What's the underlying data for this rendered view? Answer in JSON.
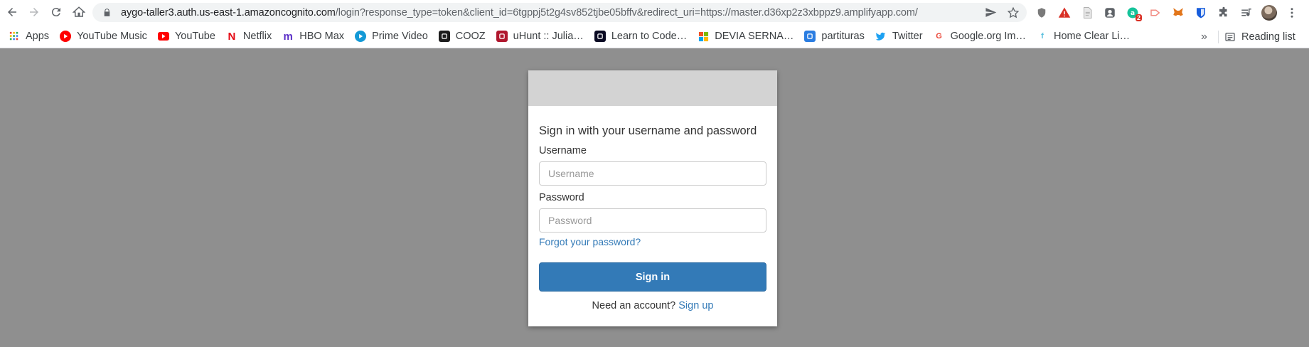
{
  "browser": {
    "url_host": "aygo-taller3.auth.us-east-1.amazoncognito.com",
    "url_path": "/login?response_type=token&client_id=6tgppj5t2g4sv852tjbe05bffv&redirect_uri=https://master.d36xp2z3xbppz9.amplifyapp.com/",
    "extension_badge": "2"
  },
  "bookmarks": {
    "items": [
      {
        "label": "Apps",
        "icon": "apps-grid-icon",
        "color": "#4285f4"
      },
      {
        "label": "YouTube Music",
        "icon": "youtube-music-icon",
        "color": "#ff0000"
      },
      {
        "label": "YouTube",
        "icon": "youtube-icon",
        "color": "#ff0000"
      },
      {
        "label": "Netflix",
        "icon": "netflix-icon",
        "color": "#e50914"
      },
      {
        "label": "HBO Max",
        "icon": "hbo-max-icon",
        "color": "#5a2ec7"
      },
      {
        "label": "Prime Video",
        "icon": "prime-video-icon",
        "color": "#1399d6"
      },
      {
        "label": "COOZ",
        "icon": "cooz-icon",
        "color": "#1d1d1d"
      },
      {
        "label": "uHunt :: Julia…",
        "icon": "uhunt-icon",
        "color": "#b0172e"
      },
      {
        "label": "Learn to Code…",
        "icon": "learn-to-code-icon",
        "color": "#0a0a23"
      },
      {
        "label": "DEVIA SERNA…",
        "icon": "microsoft-icon",
        "color": "#f25022"
      },
      {
        "label": "partituras",
        "icon": "partituras-icon",
        "color": "#2b7de1"
      },
      {
        "label": "Twitter",
        "icon": "twitter-icon",
        "color": "#1da1f2"
      },
      {
        "label": "Google.org Im…",
        "icon": "google-icon",
        "color": "#ea4335"
      },
      {
        "label": "Home Clear Li…",
        "icon": "home-clear-icon",
        "color": "#5bc0de"
      }
    ],
    "more": "»",
    "reading_list": "Reading list"
  },
  "login": {
    "heading": "Sign in with your username and password",
    "username_label": "Username",
    "username_placeholder": "Username",
    "password_label": "Password",
    "password_placeholder": "Password",
    "forgot": "Forgot your password?",
    "signin": "Sign in",
    "need_account": "Need an account?",
    "signup": "Sign up"
  },
  "colors": {
    "backdrop": "#8f8f8f",
    "primary": "#337ab7",
    "header": "#d3d3d3"
  }
}
